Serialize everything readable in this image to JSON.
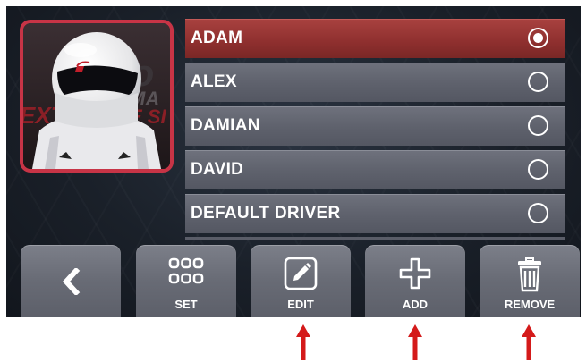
{
  "drivers": [
    {
      "name": "ADAM",
      "selected": true
    },
    {
      "name": "ALEX",
      "selected": false
    },
    {
      "name": "DAMIAN",
      "selected": false
    },
    {
      "name": "DAVID",
      "selected": false
    },
    {
      "name": "DEFAULT DRIVER",
      "selected": false
    }
  ],
  "toolbar": {
    "back": {
      "icon": "chevron-left-icon"
    },
    "set": {
      "label": "SET",
      "icon": "grid-icon"
    },
    "edit": {
      "label": "EDIT",
      "icon": "pencil-icon"
    },
    "add": {
      "label": "ADD",
      "icon": "plus-icon"
    },
    "remove": {
      "label": "REMOVE",
      "icon": "trash-icon"
    }
  },
  "colors": {
    "selected_row": "#8e2f2e",
    "row": "#5f626d",
    "avatar_border": "#c73446",
    "annotation_arrow": "#d41a1a"
  }
}
